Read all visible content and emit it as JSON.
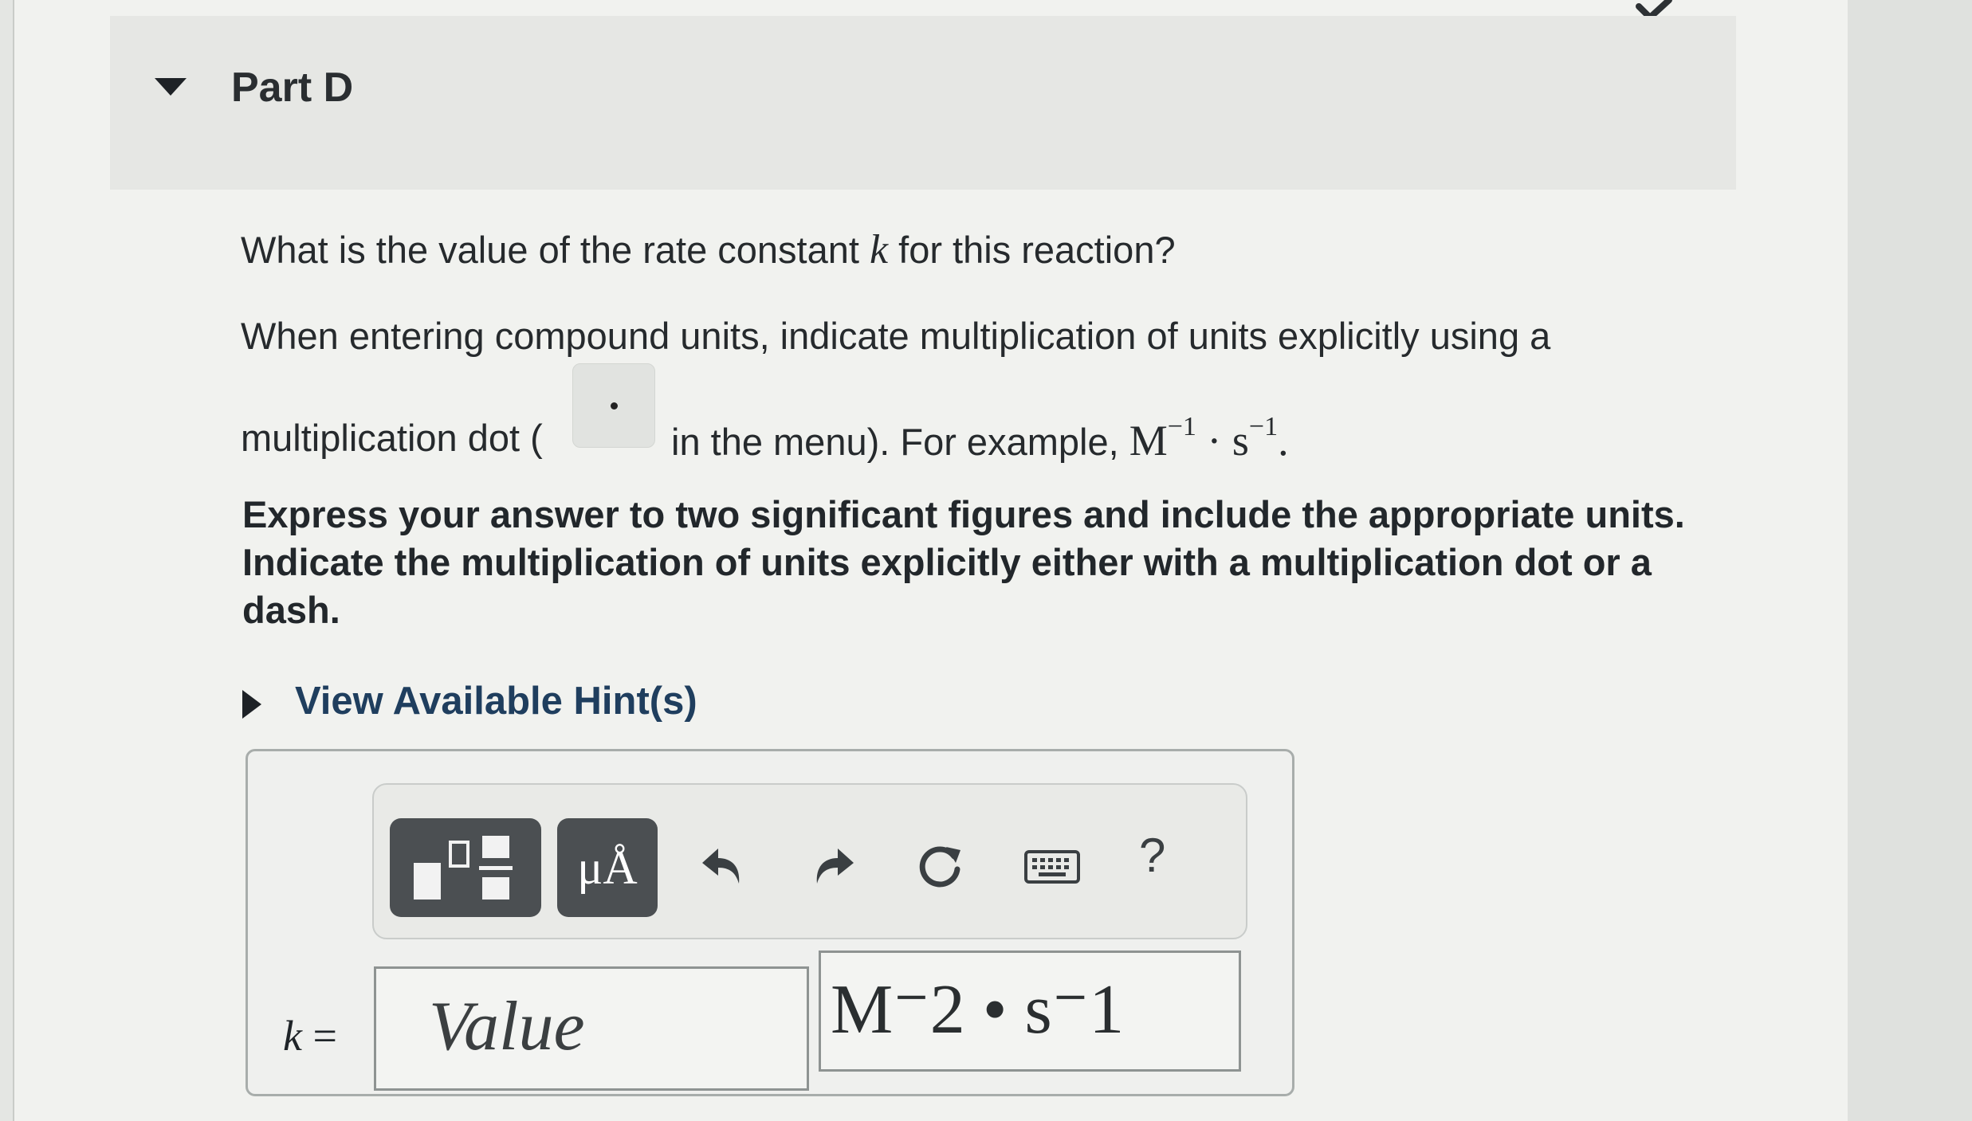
{
  "part": {
    "title": "Part D"
  },
  "question": {
    "before": "What is the value of the rate constant ",
    "variable": "k",
    "after": " for this reaction?"
  },
  "instruction": {
    "line1": "When entering compound units, indicate multiplication of units explicitly using a",
    "line2_before": "multiplication dot (",
    "line2_after": " in the menu). For example, ",
    "example_base1": "M",
    "example_exp1": "−1",
    "example_dot": " · ",
    "example_base2": "s",
    "example_exp2": "−1",
    "example_end": "."
  },
  "bold_instruction": "Express your answer to two significant figures and include the appropriate units. Indicate the multiplication of units explicitly either with a multiplication dot or a dash.",
  "hints": {
    "label": "View Available Hint(s)"
  },
  "toolbar": {
    "units_label": "μÅ",
    "help_label": "?",
    "icons": [
      "templates-icon",
      "undo-icon",
      "redo-icon",
      "reset-icon",
      "keyboard-icon"
    ]
  },
  "answer": {
    "variable": "k",
    "equals": " =",
    "value_placeholder": "Value",
    "units_value": "M⁻2 • s⁻1"
  }
}
